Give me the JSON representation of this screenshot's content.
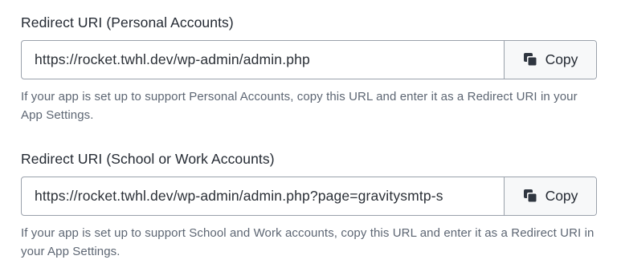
{
  "personal": {
    "label": "Redirect URI (Personal Accounts)",
    "url": "https://rocket.twhl.dev/wp-admin/admin.php",
    "copy_label": "Copy",
    "copy_icon": "copy-icon",
    "help": "If your app is set up to support Personal Accounts, copy this URL and enter it as a Redirect URI in your App Settings."
  },
  "work": {
    "label": "Redirect URI (School or Work Accounts)",
    "url": "https://rocket.twhl.dev/wp-admin/admin.php?page=gravitysmtp-s",
    "copy_label": "Copy",
    "copy_icon": "copy-icon",
    "help": "If your app is set up to support School and Work accounts, copy this URL and enter it as a Redirect URI in your App Settings."
  },
  "colors": {
    "border": "#9aa1ab",
    "button_bg": "#f7f8f9",
    "label_text": "#242a33",
    "help_text": "#5d6673"
  }
}
